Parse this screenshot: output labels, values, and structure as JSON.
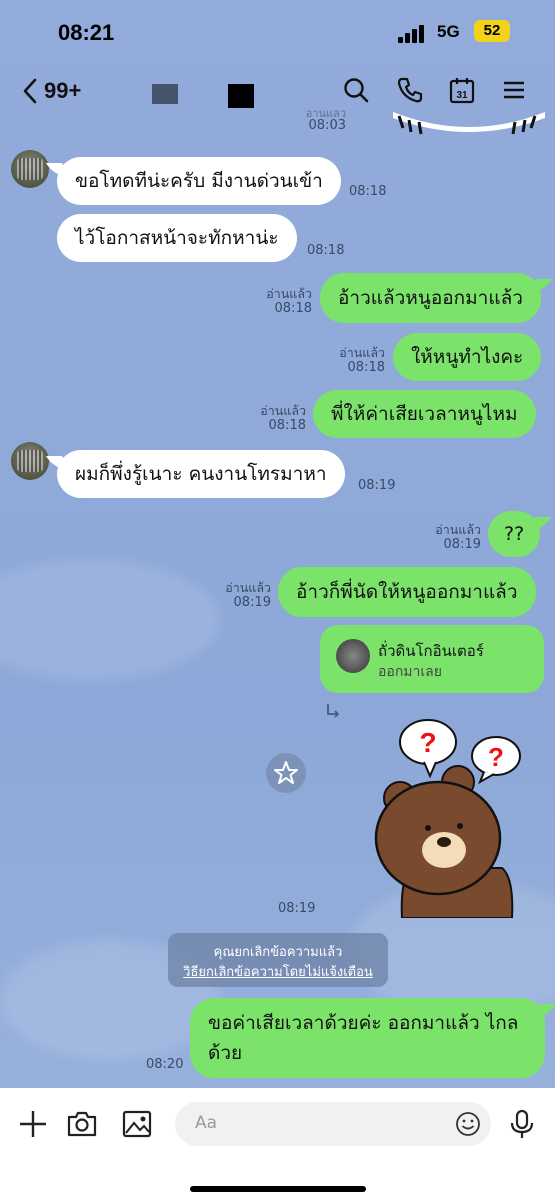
{
  "status_bar": {
    "time": "08:21",
    "network": "5G",
    "battery": "52"
  },
  "header": {
    "back_label": "99+"
  },
  "top_partial": {
    "read": "อ่านแล้ว",
    "time": "08:03"
  },
  "messages": [
    {
      "text": "ขอโทดทีน่ะครับ มีงานด่วนเข้า",
      "time": "08:18"
    },
    {
      "text": "ไว้โอกาสหน้าจะทักหาน่ะ",
      "time": "08:18"
    },
    {
      "text": "อ้าวแล้วหนูออกมาแล้ว",
      "read": "อ่านแล้ว",
      "time": "08:18"
    },
    {
      "text": "ให้หนูทำไงคะ",
      "read": "อ่านแล้ว",
      "time": "08:18"
    },
    {
      "text": "พี่ให้ค่าเสียเวลาหนูไหม",
      "read": "อ่านแล้ว",
      "time": "08:18"
    },
    {
      "text": "ผมก็พึ่งรู้เนาะ คนงานโทรมาหา",
      "time": "08:19"
    },
    {
      "text": "??",
      "read": "อ่านแล้ว",
      "time": "08:19"
    },
    {
      "text": "อ้าวก็พี่นัดให้หนูออกมาแล้ว",
      "read": "อ่านแล้ว",
      "time": "08:19"
    }
  ],
  "shared_contact": {
    "name": "ถั่วดินโกอินเตอร์",
    "subtitle": "ออกมาเลย"
  },
  "sticker_time": "08:19",
  "system_notice": {
    "line1": "คุณยกเลิกข้อความแล้ว",
    "line2": "วิธียกเลิกข้อความโดยไม่แจ้งเตือน"
  },
  "last_message": {
    "line1": "ขอค่าเสียเวลาด้วยค่ะ ออกมาแล้ว ไกล",
    "line2": "ด้วย",
    "time": "08:20"
  },
  "input": {
    "placeholder": "Aa"
  },
  "icons": [
    "chevron-left-icon",
    "search-icon",
    "phone-icon",
    "calendar-icon",
    "menu-icon",
    "star-icon",
    "forward-icon",
    "plus-icon",
    "camera-icon",
    "image-icon",
    "emoji-icon",
    "mic-icon"
  ]
}
